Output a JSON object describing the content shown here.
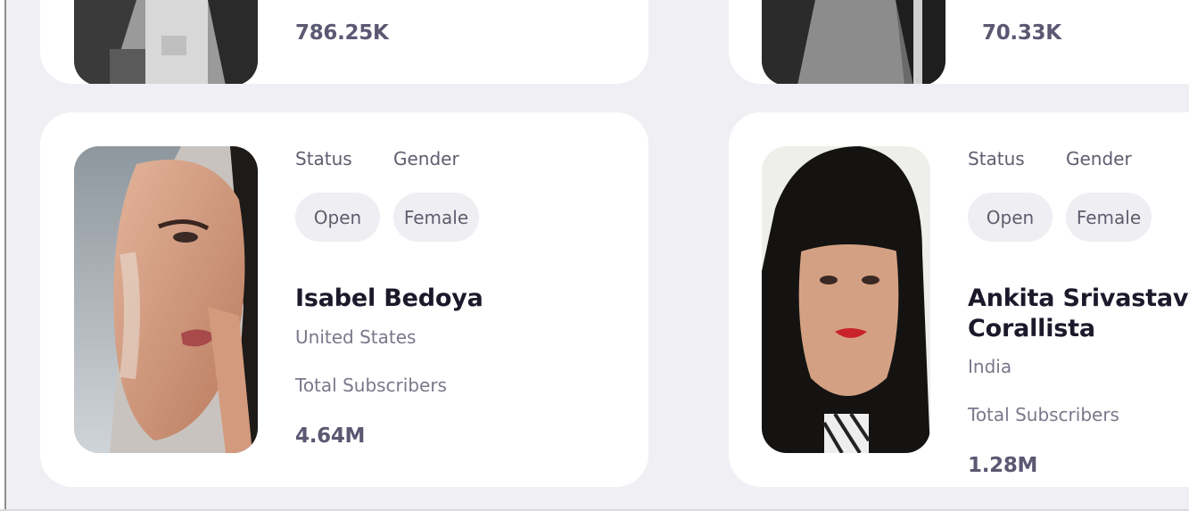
{
  "cards": [
    {
      "subscribers": "786.25K"
    },
    {
      "subscribers": "70.33K"
    },
    {
      "status_label": "Status",
      "gender_label": "Gender",
      "status": "Open",
      "gender": "Female",
      "name": "Isabel Bedoya",
      "country": "United States",
      "subscribers_label": "Total Subscribers",
      "subscribers": "4.64M"
    },
    {
      "status_label": "Status",
      "gender_label": "Gender",
      "status": "Open",
      "gender": "Female",
      "name_line1": "Ankita Srivastava",
      "name_line2": "Corallista",
      "country": "India",
      "subscribers_label": "Total Subscribers",
      "subscribers": "1.28M"
    }
  ],
  "colors": {
    "background": "#f0f0f4",
    "card": "#ffffff",
    "pill": "#efeff3",
    "name": "#1b1a2b",
    "value": "#5a5872"
  }
}
